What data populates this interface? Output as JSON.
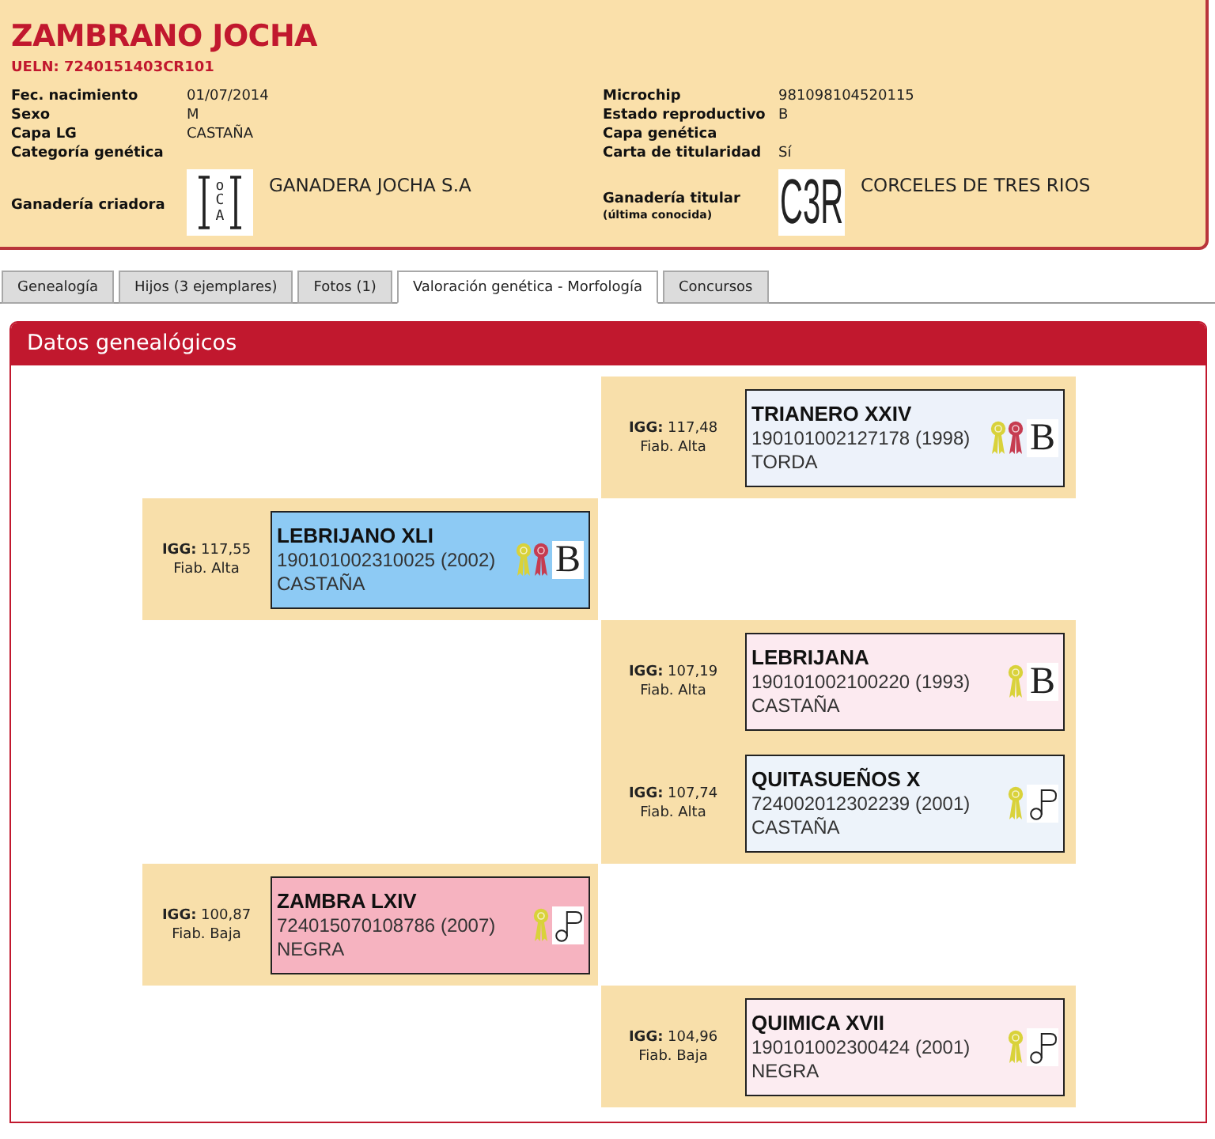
{
  "header": {
    "name": "ZAMBRANO JOCHA",
    "ueln": "UELN: 7240151403CR101",
    "details_left": [
      {
        "label": "Fec. nacimiento",
        "value": "01/07/2014"
      },
      {
        "label": "Sexo",
        "value": "M"
      },
      {
        "label": "Capa LG",
        "value": "CASTAÑA"
      },
      {
        "label": "Categoría genética"
      }
    ],
    "details_right": [
      {
        "label": "Microchip",
        "value": "981098104520115"
      },
      {
        "label": "Estado reproductivo",
        "value": "B"
      },
      {
        "label": "Capa genética"
      },
      {
        "label": "Carta de titularidad",
        "value": "Sí"
      }
    ],
    "breeder": {
      "label": "Ganadería criadora",
      "logo_letters": "oCA",
      "name": "GANADERA JOCHA S.A"
    },
    "owner": {
      "label": "Ganadería titular",
      "note": "(última conocida)",
      "logo_text": "C3R",
      "name": "CORCELES DE TRES RIOS"
    }
  },
  "tabs": [
    {
      "label": "Genealogía",
      "selected": false
    },
    {
      "label": "Hijos (3 ejemplares)",
      "selected": false
    },
    {
      "label": "Fotos (1)",
      "selected": false
    },
    {
      "label": "Valoración genética - Morfología",
      "selected": true
    },
    {
      "label": "Concursos",
      "selected": false
    }
  ],
  "panel": {
    "title": "Datos genealógicos",
    "pedigree": [
      {
        "name": "LEBRIJANO XLI",
        "registry": "190101002310025 (2002)",
        "coat": "CASTAÑA",
        "igg": "**IGG:** 117,55",
        "reliability": "Fiab. Alta",
        "color": "#8dcaf4",
        "rosettes": [
          {
            "color": "#d9d23a"
          },
          {
            "color": "#c63c50"
          }
        ],
        "symbol": {
          "kind": "letter",
          "text": "B"
        },
        "children": [
          {
            "name": "TRIANERO XXIV",
            "registry": "190101002127178 (1998)",
            "coat": "TORDA",
            "igg": "**IGG:** 117,48",
            "reliability": "Fiab. Alta",
            "color": "#edf2fa",
            "rosettes": [
              {
                "color": "#d9d23a"
              },
              {
                "color": "#c63c50"
              }
            ],
            "symbol": {
              "kind": "letter",
              "text": "B"
            }
          },
          {
            "name": "LEBRIJANA",
            "registry": "190101002100220 (1993)",
            "coat": "CASTAÑA",
            "igg": "**IGG:** 107,19",
            "reliability": "Fiab. Alta",
            "color": "#fceaf0",
            "rosettes": [
              {
                "color": "#d9d23a"
              }
            ],
            "symbol": {
              "kind": "letter",
              "text": "B"
            }
          }
        ]
      },
      {
        "name": "ZAMBRA LXIV",
        "registry": "724015070108786 (2007)",
        "coat": "NEGRA",
        "igg": "**IGG:** 100,87",
        "reliability": "Fiab. Baja",
        "color": "#f6b3c0",
        "rosettes": [
          {
            "color": "#d9d23a"
          }
        ],
        "symbol": {
          "kind": "flag"
        },
        "children": [
          {
            "name": "QUITASUEÑOS X",
            "registry": "724002012302239 (2001)",
            "coat": "CASTAÑA",
            "igg": "**IGG:** 107,74",
            "reliability": "Fiab. Alta",
            "color": "#edf3fa",
            "rosettes": [
              {
                "color": "#d9d23a"
              }
            ],
            "symbol": {
              "kind": "flag"
            }
          },
          {
            "name": "QUIMICA XVII",
            "registry": "190101002300424 (2001)",
            "coat": "NEGRA",
            "igg": "**IGG:** 104,96",
            "reliability": "Fiab. Baja",
            "color": "#fcecf1",
            "rosettes": [
              {
                "color": "#d9d23a"
              }
            ],
            "symbol": {
              "kind": "flag"
            }
          }
        ]
      }
    ]
  }
}
